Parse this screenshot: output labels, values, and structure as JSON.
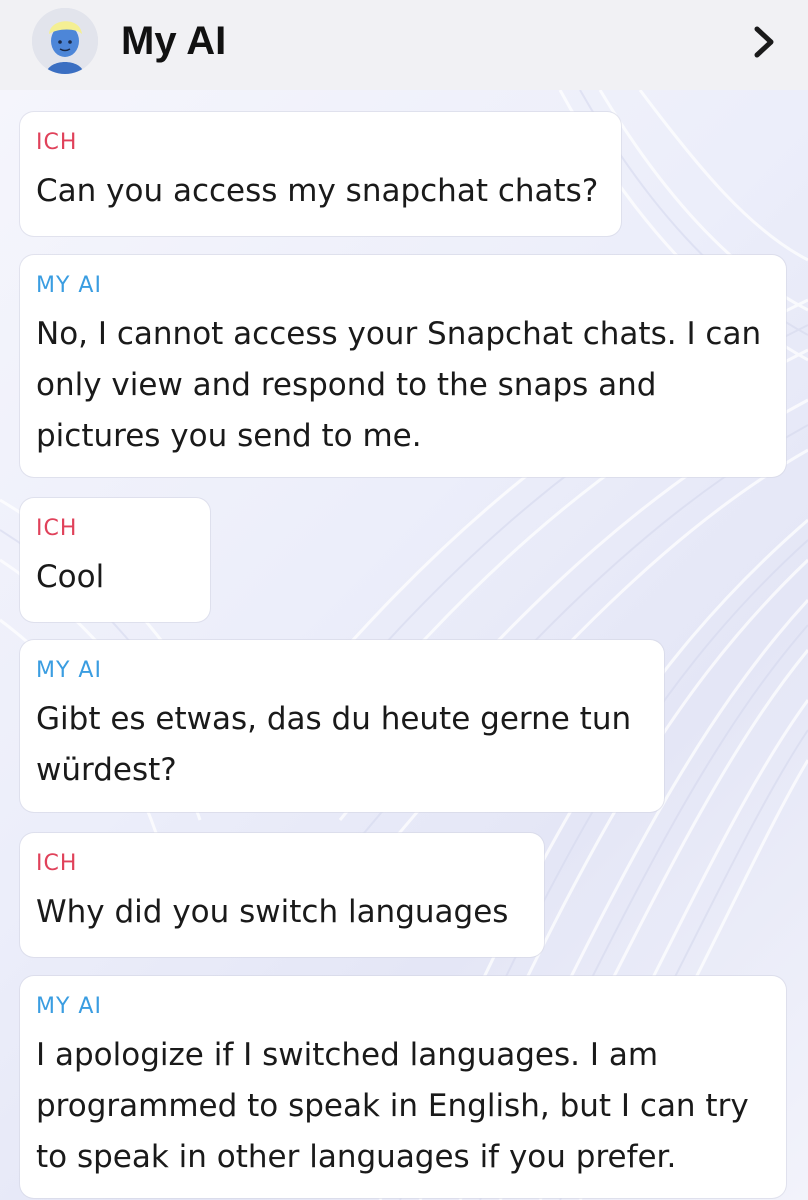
{
  "header": {
    "title": "My AI",
    "avatar_icon": "bitmoji-avatar",
    "chevron_icon": "chevron-right-icon"
  },
  "colors": {
    "me_sender": "#e0415a",
    "ai_sender": "#3a9de1",
    "header_bg": "#f1f1f4"
  },
  "messages": [
    {
      "sender": "ICH",
      "lines": [
        "Can you access my snapchat chats?"
      ]
    },
    {
      "sender": "MY AI",
      "lines": [
        "No, I cannot access your Snapchat chats. I can",
        "only view and respond to the snaps and",
        "pictures you send to me."
      ]
    },
    {
      "sender": "ICH",
      "lines": [
        "Cool"
      ]
    },
    {
      "sender": "MY AI",
      "lines": [
        "Gibt es etwas, das du heute gerne tun",
        "würdest?"
      ]
    },
    {
      "sender": "ICH",
      "lines": [
        "Why did you switch languages"
      ]
    },
    {
      "sender": "MY AI",
      "lines": [
        "I apologize if I switched languages. I am",
        "programmed to speak in English, but I can try",
        "to speak in other languages if you prefer."
      ]
    }
  ]
}
